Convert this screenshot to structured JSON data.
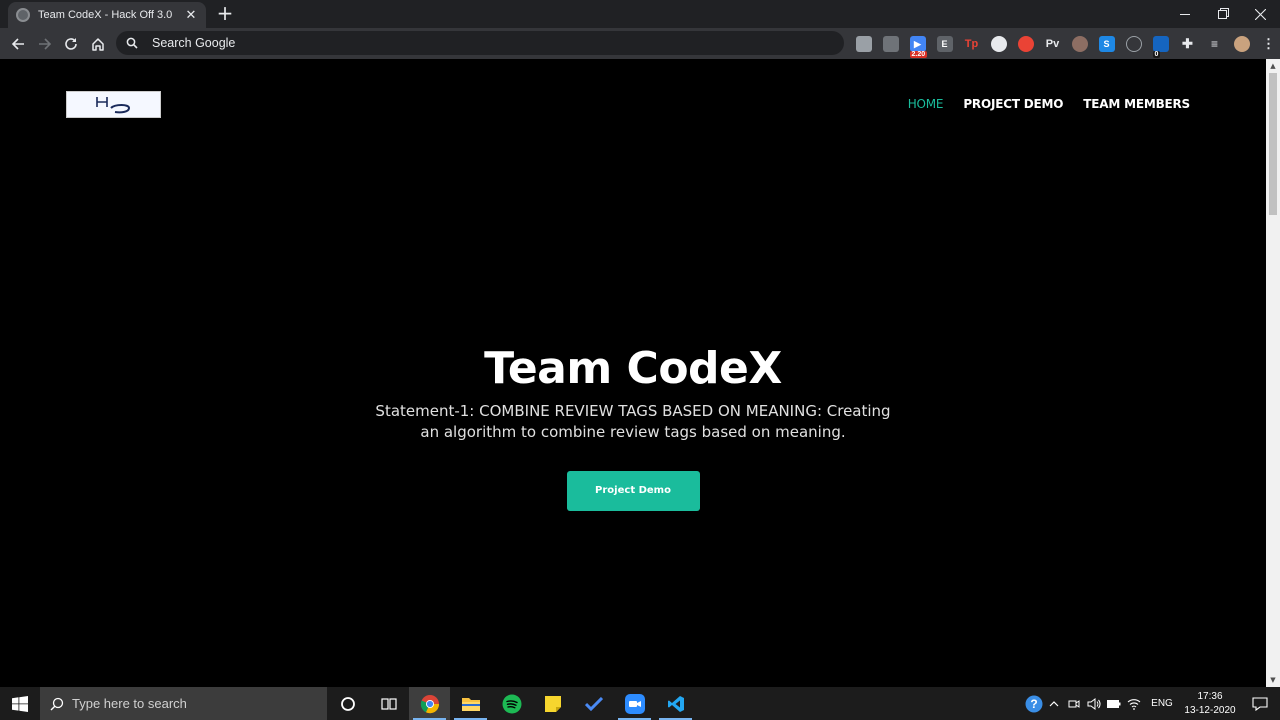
{
  "browser": {
    "tab": {
      "title": "Team CodeX - Hack Off 3.0"
    },
    "omnibox": {
      "placeholder": "Search Google"
    },
    "extensions": [
      {
        "name": "camera-ext-icon",
        "label": ""
      },
      {
        "name": "clipboard-ext-icon",
        "label": ""
      },
      {
        "name": "play-ext-icon",
        "label": "",
        "badge": "2.20"
      },
      {
        "name": "e-ext-icon",
        "label": "E"
      },
      {
        "name": "tp-ext-icon",
        "label": "Tp"
      },
      {
        "name": "puzzle-ext-icon",
        "label": ""
      },
      {
        "name": "record-ext-icon",
        "label": ""
      },
      {
        "name": "pv-ext-icon",
        "label": "Pv"
      },
      {
        "name": "cookie-ext-icon",
        "label": ""
      },
      {
        "name": "s-ext-icon",
        "label": "S"
      },
      {
        "name": "check-ext-icon",
        "label": ""
      },
      {
        "name": "p-ext-icon",
        "label": "",
        "badge": "0"
      },
      {
        "name": "extensions-icon",
        "label": ""
      },
      {
        "name": "reading-list-icon",
        "label": ""
      },
      {
        "name": "profile-avatar-icon",
        "label": ""
      },
      {
        "name": "menu-icon",
        "label": ""
      }
    ]
  },
  "site": {
    "logo_text": "H₂O",
    "nav": {
      "home": "HOME",
      "project_demo": "PROJECT DEMO",
      "team_members": "TEAM MEMBERS"
    },
    "hero": {
      "title": "Team CodeX",
      "statement": "Statement-1: COMBINE REVIEW TAGS BASED ON MEANING: Creating an algorithm to combine review tags based on meaning.",
      "cta": "Project Demo"
    },
    "accent_color": "#1abc9c"
  },
  "taskbar": {
    "search_placeholder": "Type here to search",
    "tray": {
      "language": "ENG",
      "time": "17:36",
      "date": "13-12-2020"
    }
  }
}
